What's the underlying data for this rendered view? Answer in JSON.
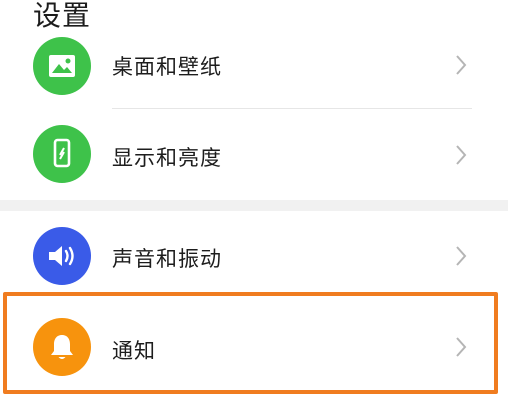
{
  "header": {
    "title": "设置"
  },
  "items": [
    {
      "label": "桌面和壁纸",
      "icon": "wallpaper-icon",
      "color": "#3ec24a"
    },
    {
      "label": "显示和亮度",
      "icon": "phone-display-icon",
      "color": "#3ec24a"
    },
    {
      "label": "声音和振动",
      "icon": "speaker-icon",
      "color": "#3a5be8"
    },
    {
      "label": "通知",
      "icon": "bell-icon",
      "color": "#f7930d"
    }
  ],
  "highlight_color": "#f07c1f"
}
